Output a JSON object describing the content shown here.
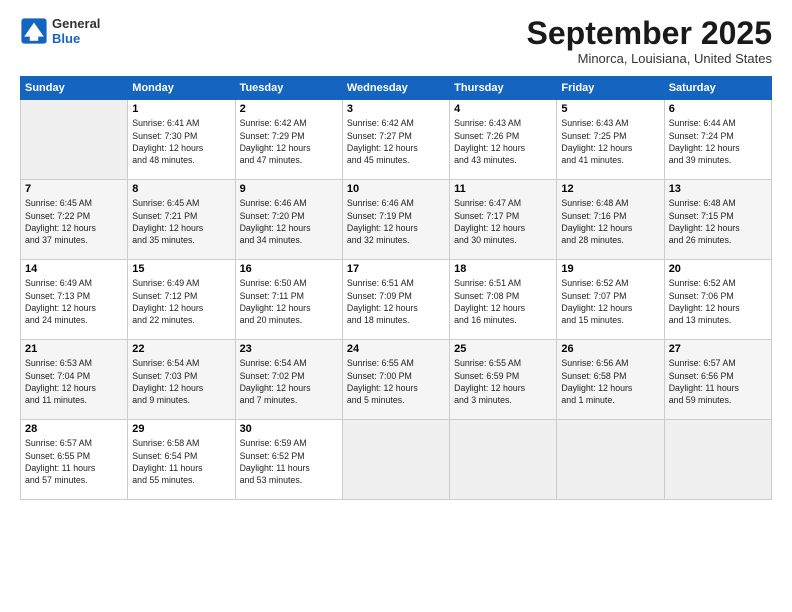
{
  "logo": {
    "line1": "General",
    "line2": "Blue"
  },
  "title": "September 2025",
  "location": "Minorca, Louisiana, United States",
  "weekdays": [
    "Sunday",
    "Monday",
    "Tuesday",
    "Wednesday",
    "Thursday",
    "Friday",
    "Saturday"
  ],
  "weeks": [
    [
      {
        "day": "",
        "text": ""
      },
      {
        "day": "1",
        "text": "Sunrise: 6:41 AM\nSunset: 7:30 PM\nDaylight: 12 hours\nand 48 minutes."
      },
      {
        "day": "2",
        "text": "Sunrise: 6:42 AM\nSunset: 7:29 PM\nDaylight: 12 hours\nand 47 minutes."
      },
      {
        "day": "3",
        "text": "Sunrise: 6:42 AM\nSunset: 7:27 PM\nDaylight: 12 hours\nand 45 minutes."
      },
      {
        "day": "4",
        "text": "Sunrise: 6:43 AM\nSunset: 7:26 PM\nDaylight: 12 hours\nand 43 minutes."
      },
      {
        "day": "5",
        "text": "Sunrise: 6:43 AM\nSunset: 7:25 PM\nDaylight: 12 hours\nand 41 minutes."
      },
      {
        "day": "6",
        "text": "Sunrise: 6:44 AM\nSunset: 7:24 PM\nDaylight: 12 hours\nand 39 minutes."
      }
    ],
    [
      {
        "day": "7",
        "text": "Sunrise: 6:45 AM\nSunset: 7:22 PM\nDaylight: 12 hours\nand 37 minutes."
      },
      {
        "day": "8",
        "text": "Sunrise: 6:45 AM\nSunset: 7:21 PM\nDaylight: 12 hours\nand 35 minutes."
      },
      {
        "day": "9",
        "text": "Sunrise: 6:46 AM\nSunset: 7:20 PM\nDaylight: 12 hours\nand 34 minutes."
      },
      {
        "day": "10",
        "text": "Sunrise: 6:46 AM\nSunset: 7:19 PM\nDaylight: 12 hours\nand 32 minutes."
      },
      {
        "day": "11",
        "text": "Sunrise: 6:47 AM\nSunset: 7:17 PM\nDaylight: 12 hours\nand 30 minutes."
      },
      {
        "day": "12",
        "text": "Sunrise: 6:48 AM\nSunset: 7:16 PM\nDaylight: 12 hours\nand 28 minutes."
      },
      {
        "day": "13",
        "text": "Sunrise: 6:48 AM\nSunset: 7:15 PM\nDaylight: 12 hours\nand 26 minutes."
      }
    ],
    [
      {
        "day": "14",
        "text": "Sunrise: 6:49 AM\nSunset: 7:13 PM\nDaylight: 12 hours\nand 24 minutes."
      },
      {
        "day": "15",
        "text": "Sunrise: 6:49 AM\nSunset: 7:12 PM\nDaylight: 12 hours\nand 22 minutes."
      },
      {
        "day": "16",
        "text": "Sunrise: 6:50 AM\nSunset: 7:11 PM\nDaylight: 12 hours\nand 20 minutes."
      },
      {
        "day": "17",
        "text": "Sunrise: 6:51 AM\nSunset: 7:09 PM\nDaylight: 12 hours\nand 18 minutes."
      },
      {
        "day": "18",
        "text": "Sunrise: 6:51 AM\nSunset: 7:08 PM\nDaylight: 12 hours\nand 16 minutes."
      },
      {
        "day": "19",
        "text": "Sunrise: 6:52 AM\nSunset: 7:07 PM\nDaylight: 12 hours\nand 15 minutes."
      },
      {
        "day": "20",
        "text": "Sunrise: 6:52 AM\nSunset: 7:06 PM\nDaylight: 12 hours\nand 13 minutes."
      }
    ],
    [
      {
        "day": "21",
        "text": "Sunrise: 6:53 AM\nSunset: 7:04 PM\nDaylight: 12 hours\nand 11 minutes."
      },
      {
        "day": "22",
        "text": "Sunrise: 6:54 AM\nSunset: 7:03 PM\nDaylight: 12 hours\nand 9 minutes."
      },
      {
        "day": "23",
        "text": "Sunrise: 6:54 AM\nSunset: 7:02 PM\nDaylight: 12 hours\nand 7 minutes."
      },
      {
        "day": "24",
        "text": "Sunrise: 6:55 AM\nSunset: 7:00 PM\nDaylight: 12 hours\nand 5 minutes."
      },
      {
        "day": "25",
        "text": "Sunrise: 6:55 AM\nSunset: 6:59 PM\nDaylight: 12 hours\nand 3 minutes."
      },
      {
        "day": "26",
        "text": "Sunrise: 6:56 AM\nSunset: 6:58 PM\nDaylight: 12 hours\nand 1 minute."
      },
      {
        "day": "27",
        "text": "Sunrise: 6:57 AM\nSunset: 6:56 PM\nDaylight: 11 hours\nand 59 minutes."
      }
    ],
    [
      {
        "day": "28",
        "text": "Sunrise: 6:57 AM\nSunset: 6:55 PM\nDaylight: 11 hours\nand 57 minutes."
      },
      {
        "day": "29",
        "text": "Sunrise: 6:58 AM\nSunset: 6:54 PM\nDaylight: 11 hours\nand 55 minutes."
      },
      {
        "day": "30",
        "text": "Sunrise: 6:59 AM\nSunset: 6:52 PM\nDaylight: 11 hours\nand 53 minutes."
      },
      {
        "day": "",
        "text": ""
      },
      {
        "day": "",
        "text": ""
      },
      {
        "day": "",
        "text": ""
      },
      {
        "day": "",
        "text": ""
      }
    ]
  ]
}
